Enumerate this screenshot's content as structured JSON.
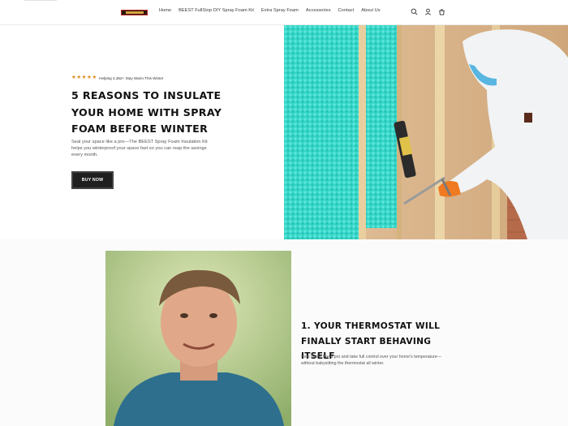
{
  "header": {
    "nav": [
      {
        "label": "Home"
      },
      {
        "label": "BEEST FullStop DIY Spray Foam Kit"
      },
      {
        "label": "Extra Spray Foam"
      },
      {
        "label": "Accessories"
      },
      {
        "label": "Contact"
      },
      {
        "label": "About Us"
      }
    ],
    "icons": [
      "search-icon",
      "account-icon",
      "cart-icon"
    ]
  },
  "hero": {
    "rating_stars": 5,
    "rating_text": "Helping 4,352+ Stay Warm This Winter",
    "title": "5 Reasons to Insulate Your Home with Spray Foam Before Winter",
    "body": "Seal your space like a pro—The BEEST Spray Foam Insulation Kit helps you winterproof your space fast so you can reap the savings every month.",
    "button_label": "BUY NOW"
  },
  "section2": {
    "title": "1. Your Thermostat Will Finally Start Behaving Itself",
    "body": "Seal drafts like a pro and take full control over your home's temperature—without babysitting the thermostat all winter."
  },
  "colors": {
    "star": "#e08a22",
    "button_bg": "#1f1f1f",
    "foam": "#2fd1c4",
    "wood": "#d8b48a"
  }
}
